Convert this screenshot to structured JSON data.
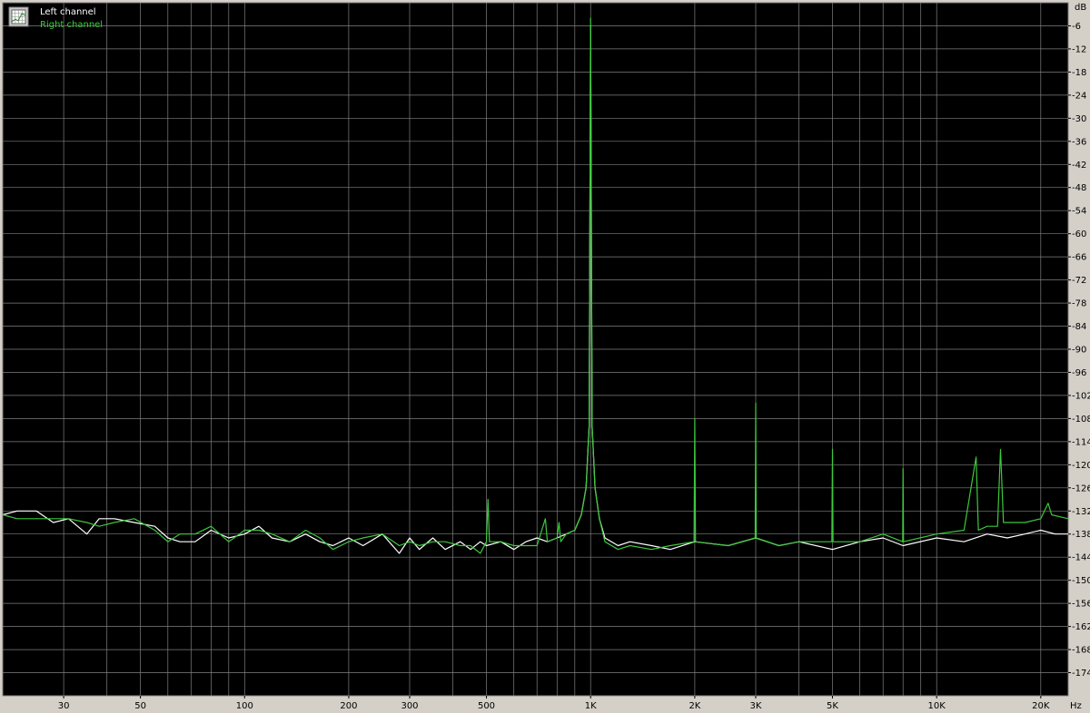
{
  "chart_data": {
    "type": "line",
    "title": "",
    "xlabel": "",
    "ylabel": "",
    "x_unit": "Hz",
    "y_unit": "dB",
    "x_scale": "log",
    "xlim": [
      20,
      24000
    ],
    "ylim": [
      -180,
      0
    ],
    "grid": true,
    "legend_position": "top-left",
    "x_ticks": [
      30,
      50,
      100,
      200,
      300,
      500,
      1000,
      2000,
      3000,
      5000,
      10000,
      20000
    ],
    "x_tick_labels": [
      "30",
      "50",
      "100",
      "200",
      "300",
      "500",
      "1K",
      "2K",
      "3K",
      "5K",
      "10K",
      "20K"
    ],
    "y_ticks": [
      -6,
      -12,
      -18,
      -24,
      -30,
      -36,
      -42,
      -48,
      -54,
      -60,
      -66,
      -72,
      -78,
      -84,
      -90,
      -96,
      -102,
      -108,
      -114,
      -120,
      -126,
      -132,
      -138,
      -144,
      -150,
      -156,
      -162,
      -168,
      -174
    ],
    "y_tick_labels": [
      "-6",
      "-12",
      "-18",
      "-24",
      "-30",
      "-36",
      "-42",
      "-48",
      "-54",
      "-60",
      "-66",
      "-72",
      "-78",
      "-84",
      "-90",
      "-96",
      "-102",
      "-108",
      "-114",
      "-120",
      "-126",
      "-132",
      "-138",
      "-144",
      "-150",
      "-156",
      "-162",
      "-168",
      "-174"
    ],
    "series": [
      {
        "name": "Left channel",
        "color": "#ffffff",
        "points": [
          [
            20,
            -133
          ],
          [
            22,
            -132
          ],
          [
            25,
            -132
          ],
          [
            28,
            -135
          ],
          [
            31,
            -134
          ],
          [
            35,
            -138
          ],
          [
            38,
            -134
          ],
          [
            42,
            -134
          ],
          [
            48,
            -135
          ],
          [
            55,
            -136
          ],
          [
            60,
            -139
          ],
          [
            65,
            -140
          ],
          [
            72,
            -140
          ],
          [
            80,
            -137
          ],
          [
            90,
            -139
          ],
          [
            100,
            -138
          ],
          [
            110,
            -136
          ],
          [
            120,
            -139
          ],
          [
            135,
            -140
          ],
          [
            150,
            -138
          ],
          [
            165,
            -140
          ],
          [
            180,
            -141
          ],
          [
            200,
            -139
          ],
          [
            220,
            -141
          ],
          [
            250,
            -138
          ],
          [
            280,
            -143
          ],
          [
            300,
            -139
          ],
          [
            320,
            -142
          ],
          [
            350,
            -139
          ],
          [
            380,
            -142
          ],
          [
            420,
            -140
          ],
          [
            450,
            -142
          ],
          [
            480,
            -140
          ],
          [
            500,
            -141
          ],
          [
            550,
            -140
          ],
          [
            600,
            -142
          ],
          [
            650,
            -140
          ],
          [
            700,
            -139
          ],
          [
            750,
            -140
          ],
          [
            800,
            -139
          ],
          [
            850,
            -138
          ],
          [
            900,
            -137
          ],
          [
            940,
            -133
          ],
          [
            970,
            -126
          ],
          [
            990,
            -110
          ],
          [
            1000,
            -6
          ],
          [
            1010,
            -110
          ],
          [
            1030,
            -126
          ],
          [
            1060,
            -134
          ],
          [
            1100,
            -139
          ],
          [
            1200,
            -141
          ],
          [
            1300,
            -140
          ],
          [
            1500,
            -141
          ],
          [
            1700,
            -142
          ],
          [
            2000,
            -140
          ],
          [
            2500,
            -141
          ],
          [
            3000,
            -139
          ],
          [
            3500,
            -141
          ],
          [
            4000,
            -140
          ],
          [
            5000,
            -142
          ],
          [
            6000,
            -140
          ],
          [
            7000,
            -139
          ],
          [
            8000,
            -141
          ],
          [
            10000,
            -139
          ],
          [
            12000,
            -140
          ],
          [
            14000,
            -138
          ],
          [
            16000,
            -139
          ],
          [
            18000,
            -138
          ],
          [
            20000,
            -137
          ],
          [
            22000,
            -138
          ],
          [
            24000,
            -138
          ]
        ]
      },
      {
        "name": "Right channel",
        "color": "#3cc83c",
        "points": [
          [
            20,
            -133
          ],
          [
            22,
            -134
          ],
          [
            25,
            -134
          ],
          [
            28,
            -134
          ],
          [
            31,
            -134
          ],
          [
            35,
            -135
          ],
          [
            38,
            -136
          ],
          [
            42,
            -135
          ],
          [
            48,
            -134
          ],
          [
            55,
            -137
          ],
          [
            60,
            -140
          ],
          [
            65,
            -138
          ],
          [
            72,
            -138
          ],
          [
            80,
            -136
          ],
          [
            90,
            -140
          ],
          [
            100,
            -137
          ],
          [
            110,
            -137
          ],
          [
            120,
            -138
          ],
          [
            135,
            -140
          ],
          [
            150,
            -137
          ],
          [
            165,
            -139
          ],
          [
            180,
            -142
          ],
          [
            200,
            -140
          ],
          [
            220,
            -139
          ],
          [
            250,
            -138
          ],
          [
            280,
            -141
          ],
          [
            300,
            -140
          ],
          [
            320,
            -141
          ],
          [
            350,
            -140
          ],
          [
            380,
            -140
          ],
          [
            420,
            -141
          ],
          [
            450,
            -141
          ],
          [
            480,
            -143
          ],
          [
            500,
            -140
          ],
          [
            505,
            -129
          ],
          [
            510,
            -140
          ],
          [
            550,
            -140
          ],
          [
            600,
            -141
          ],
          [
            650,
            -141
          ],
          [
            700,
            -141
          ],
          [
            740,
            -134
          ],
          [
            750,
            -140
          ],
          [
            800,
            -139
          ],
          [
            810,
            -135
          ],
          [
            820,
            -140
          ],
          [
            850,
            -138
          ],
          [
            900,
            -137
          ],
          [
            940,
            -133
          ],
          [
            970,
            -126
          ],
          [
            990,
            -110
          ],
          [
            1000,
            -4
          ],
          [
            1010,
            -110
          ],
          [
            1030,
            -126
          ],
          [
            1060,
            -134
          ],
          [
            1100,
            -140
          ],
          [
            1200,
            -142
          ],
          [
            1300,
            -141
          ],
          [
            1500,
            -142
          ],
          [
            1700,
            -141
          ],
          [
            1990,
            -140
          ],
          [
            2000,
            -108
          ],
          [
            2010,
            -140
          ],
          [
            2500,
            -141
          ],
          [
            2990,
            -139
          ],
          [
            3000,
            -104
          ],
          [
            3010,
            -139
          ],
          [
            3500,
            -141
          ],
          [
            4000,
            -140
          ],
          [
            4980,
            -140
          ],
          [
            5000,
            -116
          ],
          [
            5020,
            -140
          ],
          [
            6000,
            -140
          ],
          [
            7000,
            -138
          ],
          [
            7980,
            -140
          ],
          [
            8000,
            -121
          ],
          [
            8020,
            -140
          ],
          [
            10000,
            -138
          ],
          [
            12000,
            -137
          ],
          [
            13000,
            -118
          ],
          [
            13200,
            -137
          ],
          [
            14000,
            -136
          ],
          [
            15000,
            -136
          ],
          [
            15300,
            -116
          ],
          [
            15600,
            -135
          ],
          [
            16000,
            -135
          ],
          [
            18000,
            -135
          ],
          [
            20000,
            -134
          ],
          [
            21000,
            -130
          ],
          [
            21500,
            -133
          ],
          [
            24000,
            -134
          ]
        ]
      }
    ]
  }
}
